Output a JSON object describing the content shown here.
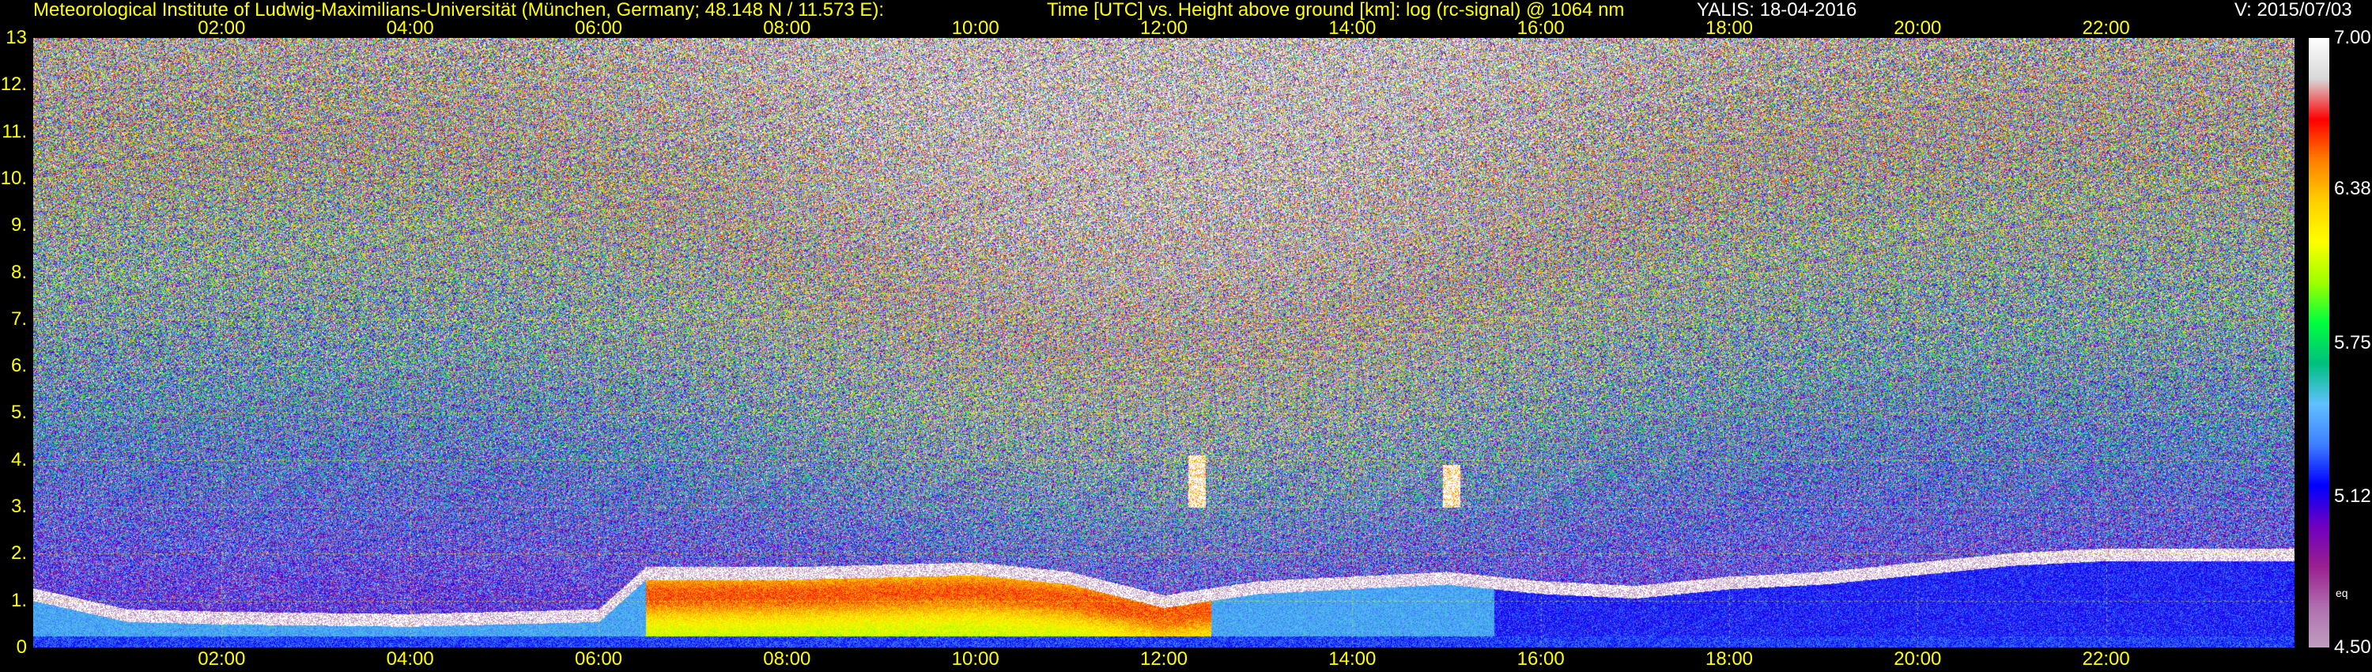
{
  "header": {
    "institute": "Meteorological Institute of Ludwig-Maximilians-Universität (München, Germany; 48.148 N / 11.573 E):",
    "description": "Time [UTC] vs. Height above ground [km]: log (rc-signal) @ 1064 nm",
    "instrument_date": "YALIS: 18-04-2016",
    "version": "V: 2015/07/03"
  },
  "colorbar": {
    "ticks": [
      "7.00",
      "6.38",
      "5.75",
      "5.12",
      "4.50"
    ],
    "unit_label": "eq",
    "colors": [
      "#ffffff",
      "#d8d8d8",
      "#ff0000",
      "#ff8000",
      "#ffd000",
      "#ffff00",
      "#a0ff00",
      "#00ff40",
      "#00c080",
      "#60c0ff",
      "#4080ff",
      "#0000ff",
      "#7000c0",
      "#9a2090",
      "#b070b0",
      "#c0a0c0"
    ]
  },
  "chart_data": {
    "type": "heatmap",
    "title": "Time [UTC] vs. Height above ground [km]: log (rc-signal) @ 1064 nm",
    "x_axis": {
      "range": [
        "00:00",
        "24:00"
      ],
      "ticks": [
        "02:00",
        "04:00",
        "06:00",
        "08:00",
        "10:00",
        "12:00",
        "14:00",
        "16:00",
        "18:00",
        "20:00",
        "22:00"
      ]
    },
    "y_axis": {
      "range": [
        0,
        13
      ],
      "unit": "km",
      "ticks": [
        "0",
        "1.",
        "2.",
        "3.",
        "4.",
        "5.",
        "6.",
        "7.",
        "8.",
        "9.",
        "10.",
        "11.",
        "12.",
        "13"
      ]
    },
    "color_range": [
      4.5,
      7.0
    ],
    "grid": true,
    "features": {
      "boundary_layer_top_km": [
        [
          0,
          1.15
        ],
        [
          1,
          0.7
        ],
        [
          2,
          0.65
        ],
        [
          4,
          0.6
        ],
        [
          6,
          0.7
        ],
        [
          6.5,
          1.6
        ],
        [
          8,
          1.6
        ],
        [
          10,
          1.7
        ],
        [
          11,
          1.5
        ],
        [
          12,
          1.0
        ],
        [
          13,
          1.3
        ],
        [
          14,
          1.4
        ],
        [
          15,
          1.5
        ],
        [
          16,
          1.3
        ],
        [
          17,
          1.2
        ],
        [
          18,
          1.4
        ],
        [
          19,
          1.5
        ],
        [
          20,
          1.7
        ],
        [
          21,
          1.9
        ],
        [
          22,
          2.0
        ],
        [
          24,
          2.0
        ]
      ],
      "cloud_events": [
        {
          "time_h": 12.35,
          "base_km": 3.0,
          "top_km": 4.1
        },
        {
          "time_h": 15.05,
          "base_km": 3.0,
          "top_km": 3.9
        }
      ]
    }
  }
}
